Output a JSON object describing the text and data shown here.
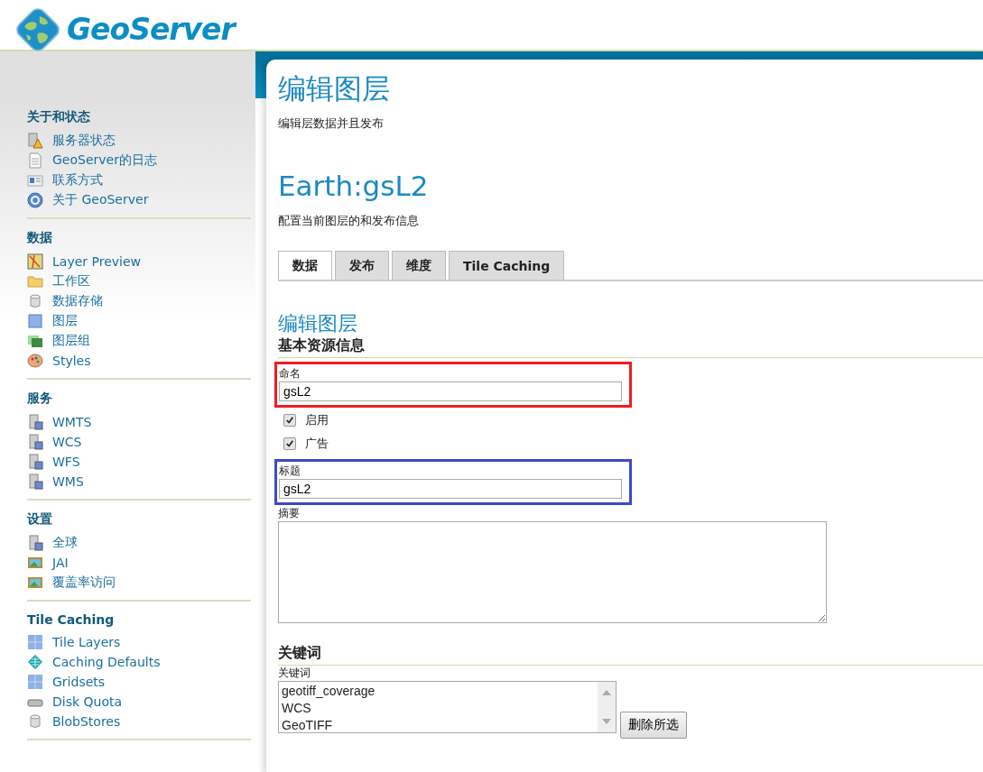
{
  "logo": {
    "text": "GeoServer"
  },
  "sidebar": [
    {
      "title": "关于和状态",
      "items": [
        "服务器状态",
        "GeoServer的日志",
        "联系方式",
        "关于 GeoServer"
      ]
    },
    {
      "title": "数据",
      "items": [
        "Layer Preview",
        "工作区",
        "数据存储",
        "图层",
        "图层组",
        "Styles"
      ]
    },
    {
      "title": "服务",
      "items": [
        "WMTS",
        "WCS",
        "WFS",
        "WMS"
      ]
    },
    {
      "title": "设置",
      "items": [
        "全球",
        "JAI",
        "覆盖率访问"
      ]
    },
    {
      "title": "Tile Caching",
      "items": [
        "Tile Layers",
        "Caching Defaults",
        "Gridsets",
        "Disk Quota",
        "BlobStores"
      ]
    }
  ],
  "page": {
    "title": "编辑图层",
    "description": "编辑层数据并且发布",
    "layer_name": "Earth:gsL2",
    "layer_description": "配置当前图层的和发布信息"
  },
  "tabs": [
    {
      "label": "数据",
      "selected": true
    },
    {
      "label": "发布",
      "selected": false
    },
    {
      "label": "维度",
      "selected": false
    },
    {
      "label": "Tile Caching",
      "selected": false
    }
  ],
  "form": {
    "title": "编辑图层",
    "section": "基本资源信息",
    "fields": [
      {
        "kind": "text",
        "label": "命名",
        "value": "gsL2",
        "color": "#ee1c25"
      },
      {
        "kind": "checkbox",
        "label": "启用",
        "checked": true
      },
      {
        "kind": "checkbox",
        "label": "广告",
        "checked": true
      },
      {
        "kind": "text",
        "label": "标题",
        "value": "gsL2",
        "color": "#3f48cc"
      },
      {
        "kind": "textarea",
        "label": "摘要"
      }
    ]
  },
  "keywords": {
    "section": "关键词",
    "label": "关键词",
    "items": [
      "geotiff_coverage",
      "WCS",
      "GeoTIFF"
    ],
    "remove_button": "删除所选"
  }
}
